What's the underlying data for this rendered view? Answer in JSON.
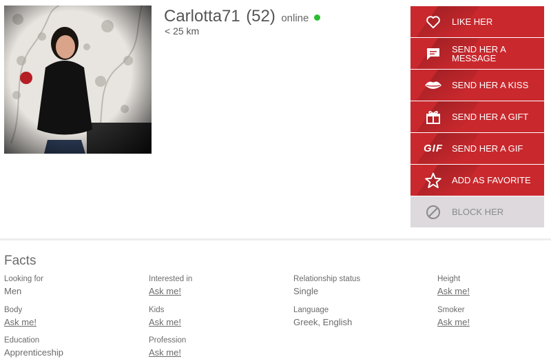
{
  "profile": {
    "username": "Carlotta71",
    "age": "(52)",
    "status": "online",
    "distance": "< 25 km",
    "online_color": "#2bbd32"
  },
  "actions": [
    {
      "label": "LIKE HER",
      "icon": "heart-icon"
    },
    {
      "label": "SEND HER A MESSAGE",
      "icon": "message-icon"
    },
    {
      "label": "SEND HER A KISS",
      "icon": "lips-icon"
    },
    {
      "label": "SEND HER A GIFT",
      "icon": "gift-icon"
    },
    {
      "label": "SEND HER A GIF",
      "icon": "gif-icon",
      "icon_text": "GIF"
    },
    {
      "label": "ADD AS FAVORITE",
      "icon": "star-icon"
    },
    {
      "label": "BLOCK HER",
      "icon": "block-icon"
    }
  ],
  "colors": {
    "action_red": "#c9282d",
    "block_bg": "#ddd9dd"
  },
  "facts": {
    "title": "Facts",
    "items": [
      {
        "label": "Looking for",
        "value": "Men",
        "ask": false
      },
      {
        "label": "Interested in",
        "value": "Ask me!",
        "ask": true
      },
      {
        "label": "Relationship status",
        "value": "Single",
        "ask": false
      },
      {
        "label": "Height",
        "value": "Ask me!",
        "ask": true
      },
      {
        "label": "Body",
        "value": "Ask me!",
        "ask": true
      },
      {
        "label": "Kids",
        "value": "Ask me!",
        "ask": true
      },
      {
        "label": "Language",
        "value": "Greek, English",
        "ask": false
      },
      {
        "label": "Smoker",
        "value": "Ask me!",
        "ask": true
      },
      {
        "label": "Education",
        "value": "Apprenticeship",
        "ask": false
      },
      {
        "label": "Profession",
        "value": "Ask me!",
        "ask": true
      }
    ]
  }
}
